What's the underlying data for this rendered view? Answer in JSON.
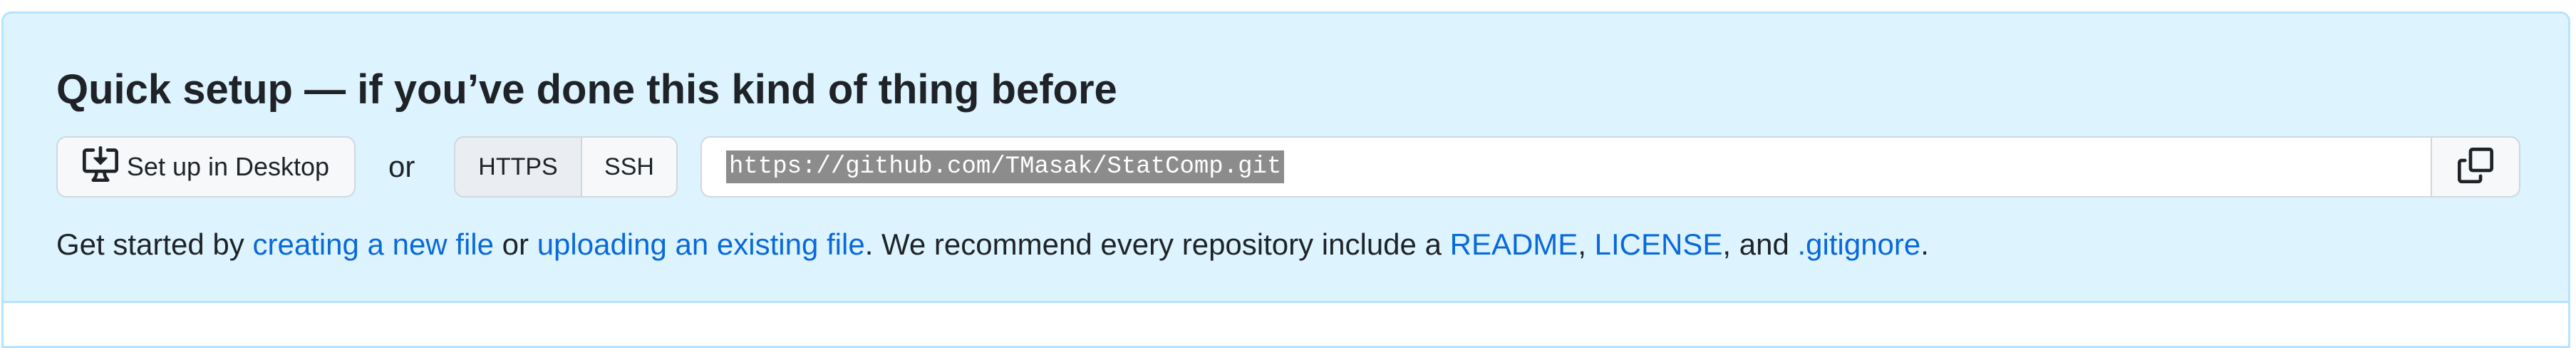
{
  "quick_setup": {
    "title": "Quick setup — if you’ve done this kind of thing before",
    "desktop_button_label": "Set up in Desktop",
    "or_label": "or",
    "protocols": [
      "HTTPS",
      "SSH"
    ],
    "selected_protocol": "HTTPS",
    "clone_url": "https://github.com/TMasak/StatComp.git",
    "info": {
      "prefix": "Get started by ",
      "link_new_file": "creating a new file",
      "middle": " or ",
      "link_upload": "uploading an existing file",
      "recommend_text": ". We recommend every repository include a ",
      "link_readme": "README",
      "comma1": ", ",
      "link_license": "LICENSE",
      "and_text": ", and ",
      "link_gitignore": ".gitignore",
      "suffix": "."
    }
  },
  "colors": {
    "panel_bg": "#ddf4ff",
    "panel_border": "#b6e3ff",
    "link": "#0969da",
    "text": "#1f2328",
    "button_bg": "#f6f8fa",
    "button_border": "#d0d7de"
  },
  "icons": {
    "desktop": "desktop-download-icon",
    "copy": "copy-icon"
  }
}
